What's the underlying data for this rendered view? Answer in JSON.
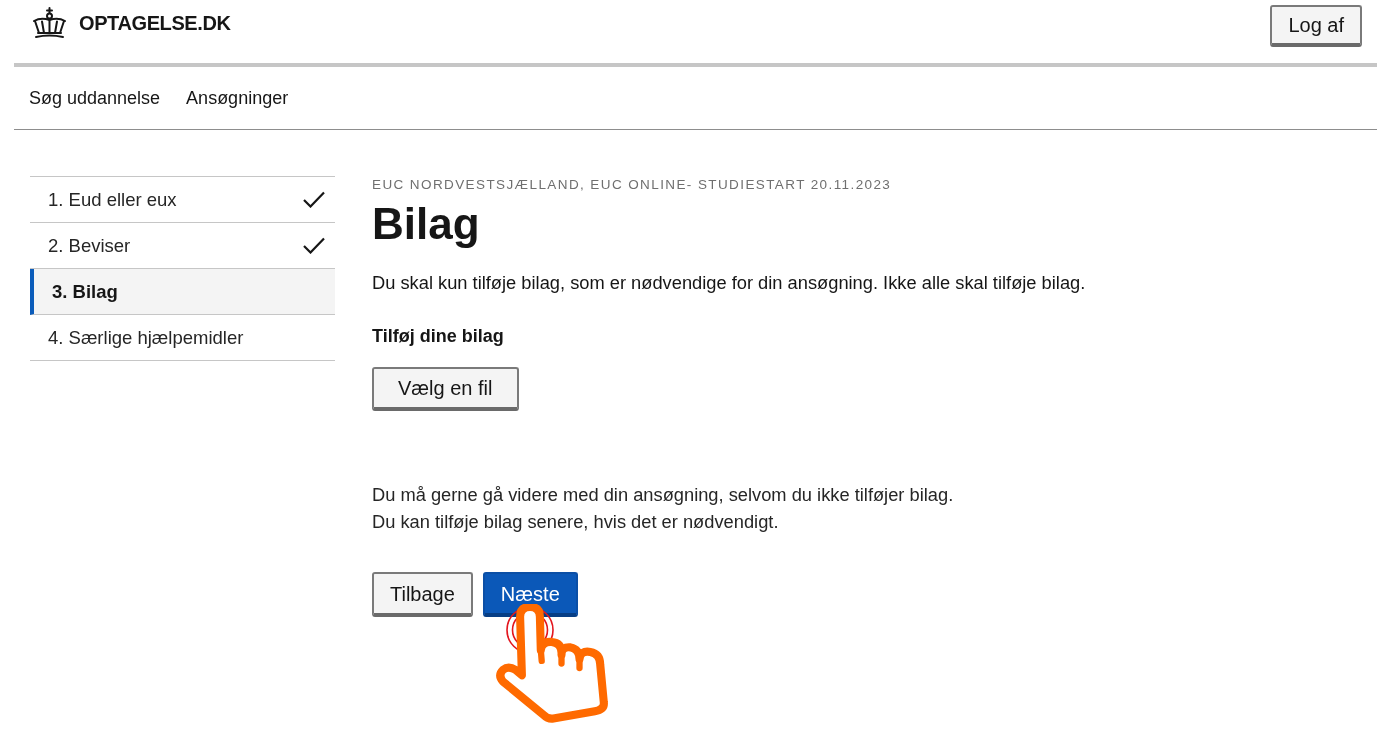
{
  "header": {
    "logo": {
      "text": "OPTAGELSE.DK"
    },
    "logout_button": "Log af"
  },
  "nav": {
    "items": [
      {
        "label": "Søg uddannelse"
      },
      {
        "label": "Ansøgninger"
      }
    ]
  },
  "steps": [
    {
      "label": "1. Eud eller eux",
      "completed": true,
      "selected": false
    },
    {
      "label": "2. Beviser",
      "completed": true,
      "selected": false
    },
    {
      "label": "3. Bilag",
      "completed": false,
      "selected": true
    },
    {
      "label": "4. Særlige hjælpemidler",
      "completed": false,
      "selected": false
    }
  ],
  "main": {
    "eyebrow": "EUC NORDVESTSJÆLLAND, EUC ONLINE- STUDIESTART 20.11.2023",
    "title": "Bilag",
    "intro": "Du skal kun tilføje bilag, som er nødvendige for din ansøgning. Ikke alle skal tilføje bilag.",
    "upload": {
      "label": "Tilføj dine bilag",
      "button": "Vælg en fil"
    },
    "notes": [
      "Du må gerne gå videre med din ansøgning, selvom du ikke tilføjer bilag.",
      "Du kan tilføje bilag senere, hvis det er nødvendigt."
    ],
    "buttons": [
      {
        "label": "Tilbage",
        "kind": "secondary",
        "clicked": false
      },
      {
        "label": "Næste",
        "kind": "primary",
        "clicked": true
      }
    ]
  }
}
